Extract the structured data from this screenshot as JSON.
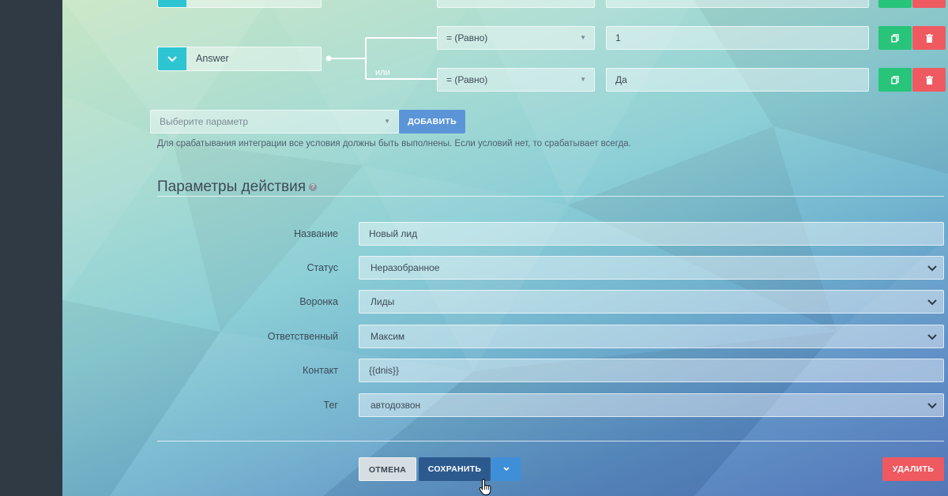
{
  "conditions": {
    "rows": [
      {
        "param": "Answer",
        "operator": "= (Равно)",
        "value": "1"
      },
      {
        "param": "Answer",
        "operator": "= (Равно)",
        "value": "Да"
      }
    ],
    "or_label": "или",
    "add_select_placeholder": "Выберите параметр",
    "add_button": "ДОБАВИТЬ",
    "hint": "Для срабатывания интеграции все условия должны быть выполнены. Если условий нет, то срабатывает всегда."
  },
  "action": {
    "title": "Параметры действия",
    "help_glyph": "?",
    "fields": {
      "name": {
        "label": "Название",
        "value": "Новый лид"
      },
      "status": {
        "label": "Статус",
        "value": "Неразобранное"
      },
      "funnel": {
        "label": "Воронка",
        "value": "Лиды"
      },
      "responsible": {
        "label": "Ответственный",
        "value": "Максим"
      },
      "contact": {
        "label": "Контакт",
        "value": "{{dnis}}"
      },
      "tag": {
        "label": "Тег",
        "value": "автодозвон"
      }
    }
  },
  "footer": {
    "cancel": "ОТМЕНА",
    "save": "СОХРАНИТЬ",
    "delete": "УДАЛИТЬ"
  },
  "colors": {
    "sidebar": "#2f3a45",
    "teal": "#2ec5d3",
    "green": "#27c47a",
    "red": "#ee5a60",
    "primary": "#2c5a8f",
    "add_blue": "#5b95d8"
  },
  "icons": {
    "copy": "copy-icon",
    "trash": "trash-icon",
    "chevron": "chevron-down-icon",
    "cursor": "hand-cursor-icon"
  }
}
